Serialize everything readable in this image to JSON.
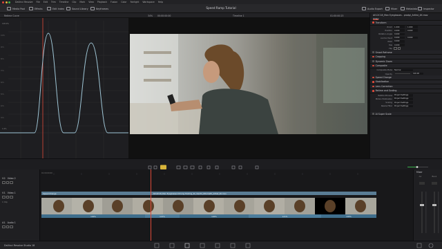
{
  "menubar": {
    "items": [
      "DaVinci Resolve",
      "File",
      "Edit",
      "Trim",
      "Timeline",
      "Clip",
      "Mark",
      "View",
      "Playback",
      "Fusion",
      "Color",
      "Fairlight",
      "Workspace",
      "Help"
    ]
  },
  "toolbar": {
    "media_pool": "Media Pool",
    "effects": "Effects",
    "edit_index": "Edit Index",
    "sound_library": "Sound Library",
    "keyframes": "Keyframes",
    "project_title": "Speed Ramp Tutorial",
    "audio_export": "Audio Export",
    "mixer": "Mixer",
    "metadata": "Metadata",
    "inspector": "Inspector"
  },
  "subbar": {
    "curve_dropdown": "Retime Curve",
    "zoom": "34%",
    "source_tc": "00:00:00:00",
    "timeline_name": "Timeline 1",
    "record_tc": "01:00:00:23",
    "clip_name": "A012C18_Man Eyeglasses..."
  },
  "curve": {
    "y_labels": [
      "100%",
      "90%",
      "80%",
      "70%",
      "60%",
      "50%",
      "40%",
      "30%",
      "20%",
      "10%",
      "0%"
    ],
    "top_label": "128.0%",
    "bottom_label": "1.0%"
  },
  "inspector": {
    "clip_title": "A012C18_Man Eyeglasses - prodpl_Artlist_4K.mov",
    "tabs": [
      "Video",
      "Audio",
      "Effects",
      "Transition",
      "Image",
      "File"
    ],
    "sections": {
      "transform": "Transform",
      "smart_reframe": "Smart Reframe",
      "cropping": "Cropping",
      "dynamic_zoom": "Dynamic Zoom",
      "composite": "Composite",
      "speed_change": "Speed Change",
      "stabilization": "Stabilization",
      "lens_correction": "Lens Correction",
      "retime_scaling": "Retime and Scaling",
      "super_scale": "AI Super Scale"
    },
    "transform_props": [
      {
        "label": "Zoom",
        "x": "1.000",
        "y": "1.000"
      },
      {
        "label": "Position",
        "x": "0.000",
        "y": "0.000"
      },
      {
        "label": "Rotation Angle",
        "x": "0.000",
        "y": ""
      },
      {
        "label": "Anchor Point",
        "x": "0.000",
        "y": "0.000"
      },
      {
        "label": "Pitch",
        "x": "0.000",
        "y": ""
      },
      {
        "label": "Yaw",
        "x": "0.000",
        "y": ""
      },
      {
        "label": "Flip",
        "x": "",
        "y": ""
      }
    ],
    "composite_props": [
      {
        "label": "Composite Mode",
        "value": "Normal"
      },
      {
        "label": "Opacity",
        "value": "100.00"
      }
    ],
    "retime_props": [
      {
        "label": "Retime Process",
        "value": "Project Settings"
      },
      {
        "label": "Motion Estimation",
        "value": "Project Settings"
      },
      {
        "label": "Scaling",
        "value": "Project Settings"
      },
      {
        "label": "Resize Filter",
        "value": "Project Settings"
      }
    ]
  },
  "timeline": {
    "timecode": "01:00:00:23",
    "ruler_tc": "01:00:00:00",
    "tracks": [
      {
        "id": "V2",
        "name": "Video 2"
      },
      {
        "id": "V1",
        "name": "Video 1",
        "sub": "1 Clip"
      },
      {
        "id": "A1",
        "name": "Audio 1",
        "level": "2.0"
      }
    ],
    "speed_change_label": "Speed Change",
    "clip_label": "A012C18_Man Eyeglasses Driving Holding_4k_Vault4_Ottomatti_Artlist_4K.mov",
    "speed_segments": [
      "100%",
      "121%",
      "100%",
      "121%",
      "100%"
    ]
  },
  "mixer": {
    "title": "Mixer",
    "channel": "A1",
    "bus": "Bus1",
    "level": "0.0"
  },
  "pagebar": {
    "app_name": "DaVinci Resolve Studio 18"
  },
  "colors": {
    "accent": "#e04a3a",
    "clip_blue": "#5a7d95",
    "curve": "#9fc6d6",
    "highlight": "#d8b43a"
  }
}
